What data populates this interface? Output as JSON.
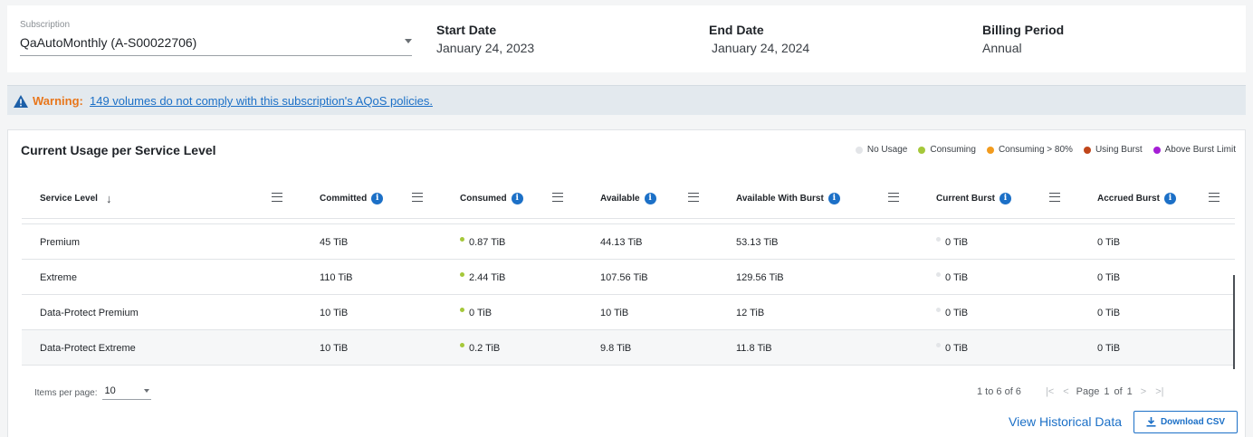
{
  "subscription": {
    "label": "Subscription",
    "value": "QaAutoMonthly (A-S00022706)"
  },
  "summary": [
    {
      "label": "Start Date",
      "value": "January 24, 2023"
    },
    {
      "label": "End Date",
      "value": "January 24, 2024"
    },
    {
      "label": "Billing Period",
      "value": "Annual"
    }
  ],
  "warning": {
    "label": "Warning:",
    "message": "149 volumes do not comply with this subscription's AQoS policies."
  },
  "usage": {
    "title": "Current Usage per Service Level",
    "legend": [
      {
        "label": "No Usage",
        "color": "#e3e5e8"
      },
      {
        "label": "Consuming",
        "color": "#a5c83a"
      },
      {
        "label": "Consuming > 80%",
        "color": "#f29b1e"
      },
      {
        "label": "Using Burst",
        "color": "#c0461a"
      },
      {
        "label": "Above Burst Limit",
        "color": "#a51fd6"
      }
    ],
    "columns": [
      "Service Level",
      "Committed",
      "Consumed",
      "Available",
      "Available With Burst",
      "Current Burst",
      "Accrued Burst"
    ],
    "rows": [
      {
        "level": "Premium",
        "committed": "45 TiB",
        "consumed": "0.87 TiB",
        "available": "44.13 TiB",
        "burst_available": "53.13 TiB",
        "current_burst": "0 TiB",
        "accrued": "0 TiB"
      },
      {
        "level": "Extreme",
        "committed": "110 TiB",
        "consumed": "2.44 TiB",
        "available": "107.56 TiB",
        "burst_available": "129.56 TiB",
        "current_burst": "0 TiB",
        "accrued": "0 TiB"
      },
      {
        "level": "Data-Protect Premium",
        "committed": "10 TiB",
        "consumed": "0 TiB",
        "available": "10 TiB",
        "burst_available": "12 TiB",
        "current_burst": "0 TiB",
        "accrued": "0 TiB"
      },
      {
        "level": "Data-Protect Extreme",
        "committed": "10 TiB",
        "consumed": "0.2 TiB",
        "available": "9.8 TiB",
        "burst_available": "11.8 TiB",
        "current_burst": "0 TiB",
        "accrued": "0 TiB"
      }
    ]
  },
  "pagination": {
    "items_label": "Items per page:",
    "items_value": "10",
    "range": "1 to 6 of 6",
    "page_label": "Page",
    "page_current": "1",
    "page_of": "of",
    "page_total": "1"
  },
  "actions": {
    "history": "View Historical Data",
    "csv": "Download CSV"
  }
}
